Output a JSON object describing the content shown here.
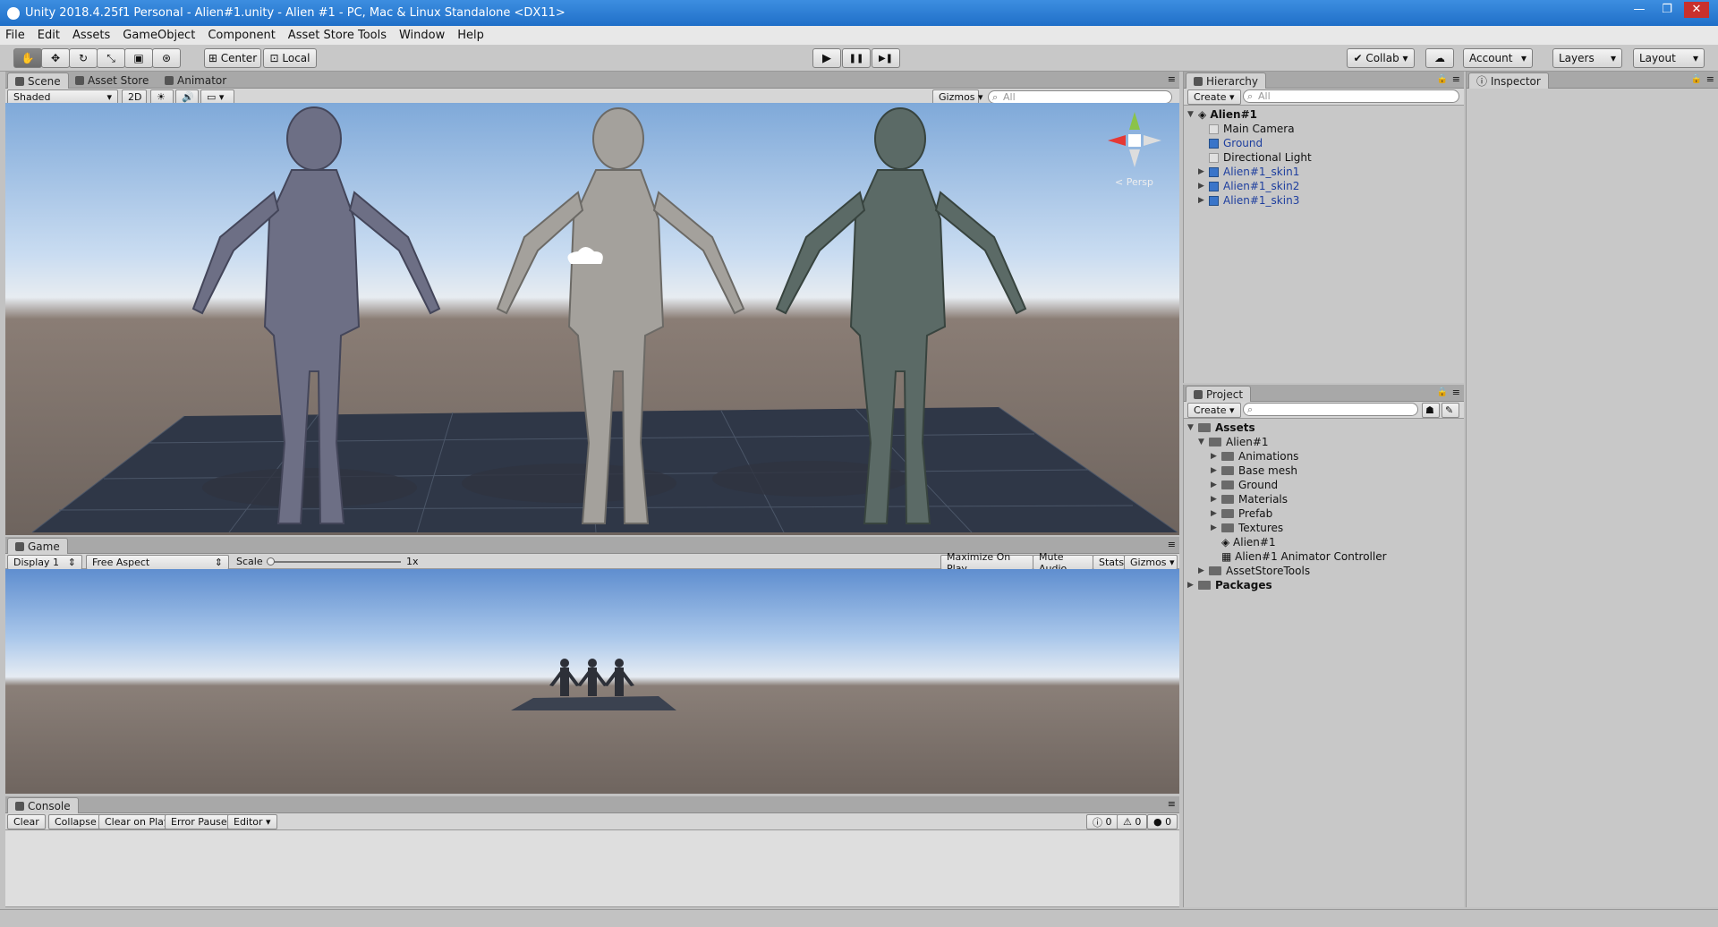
{
  "window": {
    "title": "Unity 2018.4.25f1 Personal - Alien#1.unity - Alien #1 - PC, Mac & Linux Standalone <DX11>",
    "min": "—",
    "max": "❐",
    "close": "✕"
  },
  "menu": [
    "File",
    "Edit",
    "Assets",
    "GameObject",
    "Component",
    "Asset Store Tools",
    "Window",
    "Help"
  ],
  "toolbar": {
    "center": "Center",
    "local": "Local",
    "collab": "Collab",
    "account": "Account",
    "layers": "Layers",
    "layout": "Layout",
    "play": "▶",
    "pause": "❚❚",
    "step": "▶❚"
  },
  "scene": {
    "tabs": [
      "Scene",
      "Asset Store",
      "Animator"
    ],
    "shading": "Shaded",
    "mode2d": "2D",
    "gizmos": "Gizmos",
    "search_placeholder": "All",
    "persp": "< Persp"
  },
  "game": {
    "tab": "Game",
    "display": "Display 1",
    "aspect": "Free Aspect",
    "scale_label": "Scale",
    "scale_value": "1x",
    "maximize": "Maximize On Play",
    "mute": "Mute Audio",
    "stats": "Stats",
    "gizmos": "Gizmos"
  },
  "console": {
    "tab": "Console",
    "clear": "Clear",
    "collapse": "Collapse",
    "clear_on_play": "Clear on Play",
    "error_pause": "Error Pause",
    "editor": "Editor",
    "info_count": "0",
    "warn_count": "0",
    "error_count": "0"
  },
  "hierarchy": {
    "tab": "Hierarchy",
    "create": "Create",
    "search_placeholder": "All",
    "root": "Alien#1",
    "items": [
      "Main Camera",
      "Ground",
      "Directional Light",
      "Alien#1_skin1",
      "Alien#1_skin2",
      "Alien#1_skin3"
    ]
  },
  "project": {
    "tab": "Project",
    "create": "Create",
    "assets": "Assets",
    "alien_folder": "Alien#1",
    "subfolders": [
      "Animations",
      "Base mesh",
      "Ground",
      "Materials",
      "Prefab",
      "Textures"
    ],
    "files": [
      "Alien#1",
      "Alien#1 Animator Controller"
    ],
    "asset_store_tools": "AssetStoreTools",
    "packages": "Packages"
  },
  "inspector": {
    "tab": "Inspector"
  }
}
